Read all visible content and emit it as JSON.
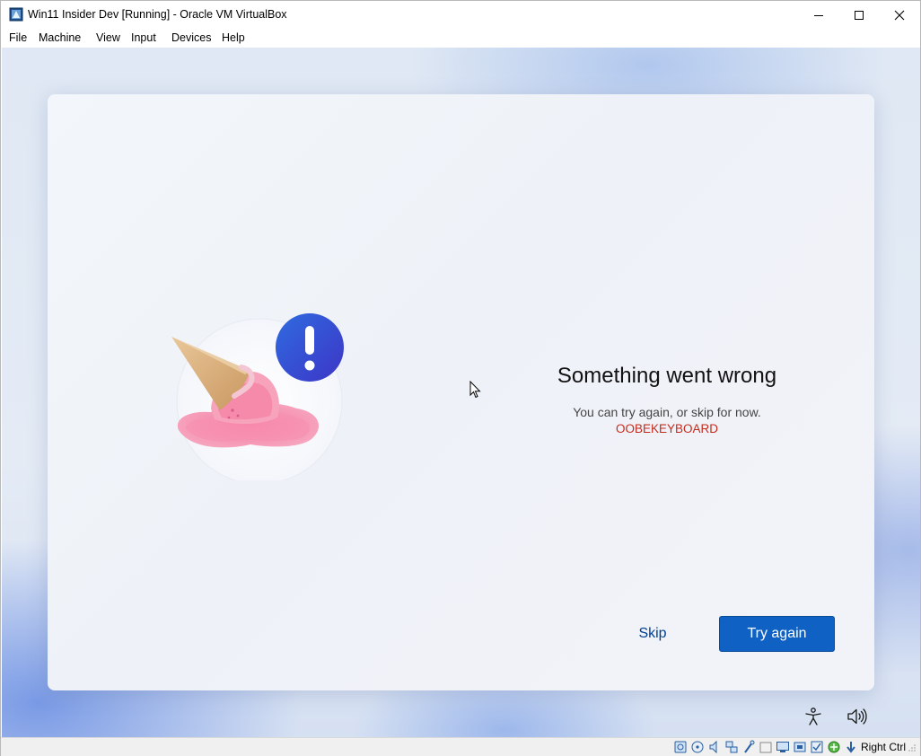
{
  "window": {
    "title": "Win11 Insider Dev [Running] - Oracle VM VirtualBox",
    "app_icon": "virtualbox-icon"
  },
  "menu": {
    "items": [
      "File",
      "Machine",
      "View",
      "Input",
      "Devices",
      "Help"
    ]
  },
  "oobe": {
    "headline": "Something went wrong",
    "subtext": "You can try again, or skip for now.",
    "error_code": "OOBEKEYBOARD",
    "skip_label": "Skip",
    "try_again_label": "Try again",
    "illustration": "melted-ice-cream-with-exclamation",
    "accent": "#0f62c4",
    "error_color": "#c42b1c"
  },
  "tray": {
    "accessibility_icon": "accessibility-icon",
    "volume_icon": "volume-icon"
  },
  "statusbar": {
    "icons": [
      "hard-disk-icon",
      "optical-drive-icon",
      "audio-icon",
      "network-icon",
      "usb-icon",
      "shared-folders-icon",
      "display-icon",
      "video-capture-icon",
      "cpu-icon",
      "guest-additions-icon",
      "mouse-integration-icon"
    ],
    "host_key": "Right Ctrl"
  }
}
